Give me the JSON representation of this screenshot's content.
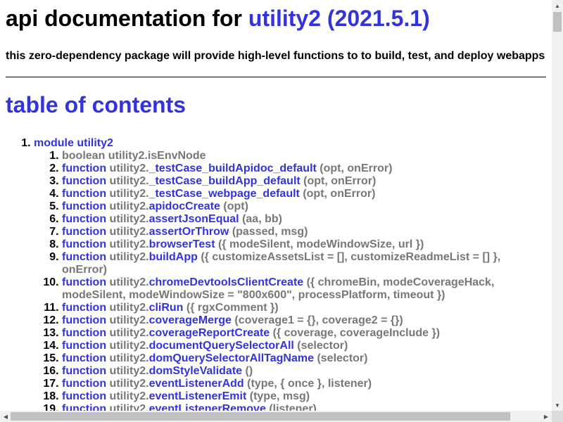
{
  "header": {
    "title_prefix": "api documentation for ",
    "title_package": "utility2 (2021.5.1)",
    "description": "this zero-dependency package will provide high-level functions to to build, test, and deploy webapps"
  },
  "toc": {
    "title": "table of contents",
    "module": {
      "label": "module utility2",
      "namespace": "utility2.",
      "members": [
        {
          "kind": "boolean",
          "name": "isEnvNode",
          "signature": "",
          "linked": false
        },
        {
          "kind": "function",
          "name": "_testCase_buildApidoc_default",
          "signature": "(opt, onError)",
          "linked": true
        },
        {
          "kind": "function",
          "name": "_testCase_buildApp_default",
          "signature": "(opt, onError)",
          "linked": true
        },
        {
          "kind": "function",
          "name": "_testCase_webpage_default",
          "signature": "(opt, onError)",
          "linked": true
        },
        {
          "kind": "function",
          "name": "apidocCreate",
          "signature": "(opt)",
          "linked": true
        },
        {
          "kind": "function",
          "name": "assertJsonEqual",
          "signature": "(aa, bb)",
          "linked": true
        },
        {
          "kind": "function",
          "name": "assertOrThrow",
          "signature": "(passed, msg)",
          "linked": true
        },
        {
          "kind": "function",
          "name": "browserTest",
          "signature": "({ modeSilent, modeWindowSize, url })",
          "linked": true
        },
        {
          "kind": "function",
          "name": "buildApp",
          "signature": "({ customizeAssetsList = [], customizeReadmeList = [] }, onError)",
          "linked": true
        },
        {
          "kind": "function",
          "name": "chromeDevtoolsClientCreate",
          "signature": "({ chromeBin, modeCoverageHack, modeSilent, modeWindowSize = \"800x600\", processPlatform, timeout })",
          "linked": true
        },
        {
          "kind": "function",
          "name": "cliRun",
          "signature": "({ rgxComment })",
          "linked": true
        },
        {
          "kind": "function",
          "name": "coverageMerge",
          "signature": "(coverage1 = {}, coverage2 = {})",
          "linked": true
        },
        {
          "kind": "function",
          "name": "coverageReportCreate",
          "signature": "({ coverage, coverageInclude })",
          "linked": true
        },
        {
          "kind": "function",
          "name": "documentQuerySelectorAll",
          "signature": "(selector)",
          "linked": true
        },
        {
          "kind": "function",
          "name": "domQuerySelectorAllTagName",
          "signature": "(selector)",
          "linked": true
        },
        {
          "kind": "function",
          "name": "domStyleValidate",
          "signature": "()",
          "linked": true
        },
        {
          "kind": "function",
          "name": "eventListenerAdd",
          "signature": "(type, { once }, listener)",
          "linked": true
        },
        {
          "kind": "function",
          "name": "eventListenerEmit",
          "signature": "(type, msg)",
          "linked": true
        },
        {
          "kind": "function",
          "name": "eventListenerRemove",
          "signature": "(listener)",
          "linked": true
        }
      ]
    }
  },
  "colors": {
    "link": "#3333dd",
    "muted": "#777777",
    "text": "#000000"
  }
}
